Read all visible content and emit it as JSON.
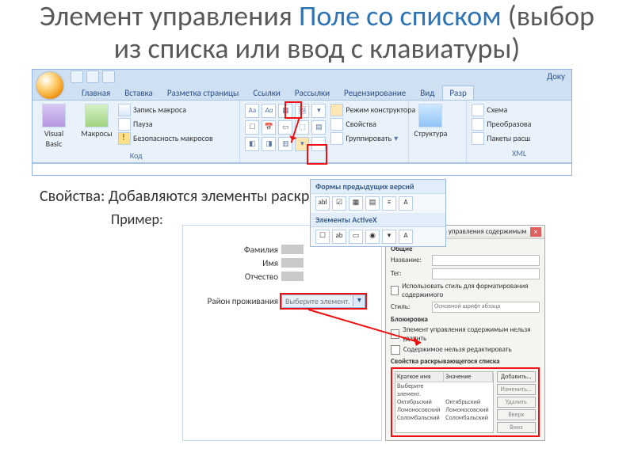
{
  "title": {
    "pre": "Элемент управления ",
    "accent": "Поле со списком",
    "post": " (выбор из списка или ввод с клавиатуры)"
  },
  "qat": {
    "doc": "Доку"
  },
  "tabs": [
    "Главная",
    "Вставка",
    "Разметка страницы",
    "Ссылки",
    "Рассылки",
    "Рецензирование",
    "Вид",
    "Разр"
  ],
  "ribbon": {
    "code": {
      "vb": "Visual Basic",
      "macros": "Макросы",
      "rec": "Запись макроса",
      "pause": "Пауза",
      "sec": "Безопасность макросов",
      "label": "Код"
    },
    "controls": {
      "aa": "Aa",
      "design": "Режим конструктора",
      "props": "Свойства",
      "group": "Группировать"
    },
    "structure": {
      "btn": "Структура"
    },
    "xml": {
      "schema": "Схема",
      "transform": "Преобразова",
      "packs": "Пакеты расш",
      "label": "XML"
    }
  },
  "flyout": {
    "legacy": "Формы предыдущих версий",
    "abl": "abl",
    "activex": "Элементы ActiveX"
  },
  "note": "Свойства: Добавляются  элементы раскрывающегося списка",
  "example": "Пример:",
  "doc": {
    "fam": "Фамилия",
    "name": "Имя",
    "mid": "Отчество",
    "region": "Район проживания",
    "placeholder": "Выберите элемент."
  },
  "props": {
    "title": "Свойства элемента управления содержимым",
    "general": "Общие",
    "nameLab": "Название:",
    "tagLab": "Тег:",
    "useStyle": "Использовать стиль для форматирования содержимого",
    "styleLab": "Стиль:",
    "styleVal": "Основной шрифт абзаца",
    "lock": "Блокировка",
    "lock1": "Элемент управления содержимым нельзя удалить",
    "lock2": "Содержимое нельзя редактировать",
    "dropSection": "Свойства раскрывающегося списка",
    "col1": "Краткое имя",
    "col2": "Значение",
    "rows": [
      [
        "Выберите элемент.",
        ""
      ],
      [
        "Октябрьский",
        "Октябрьский"
      ],
      [
        "Ломоносовский",
        "Ломоносовский"
      ],
      [
        "Соломбальский",
        "Соломбальский"
      ]
    ],
    "btns": {
      "add": "Добавить...",
      "edit": "Изменить...",
      "del": "Удалить",
      "up": "Вверх",
      "down": "Вниз"
    }
  }
}
